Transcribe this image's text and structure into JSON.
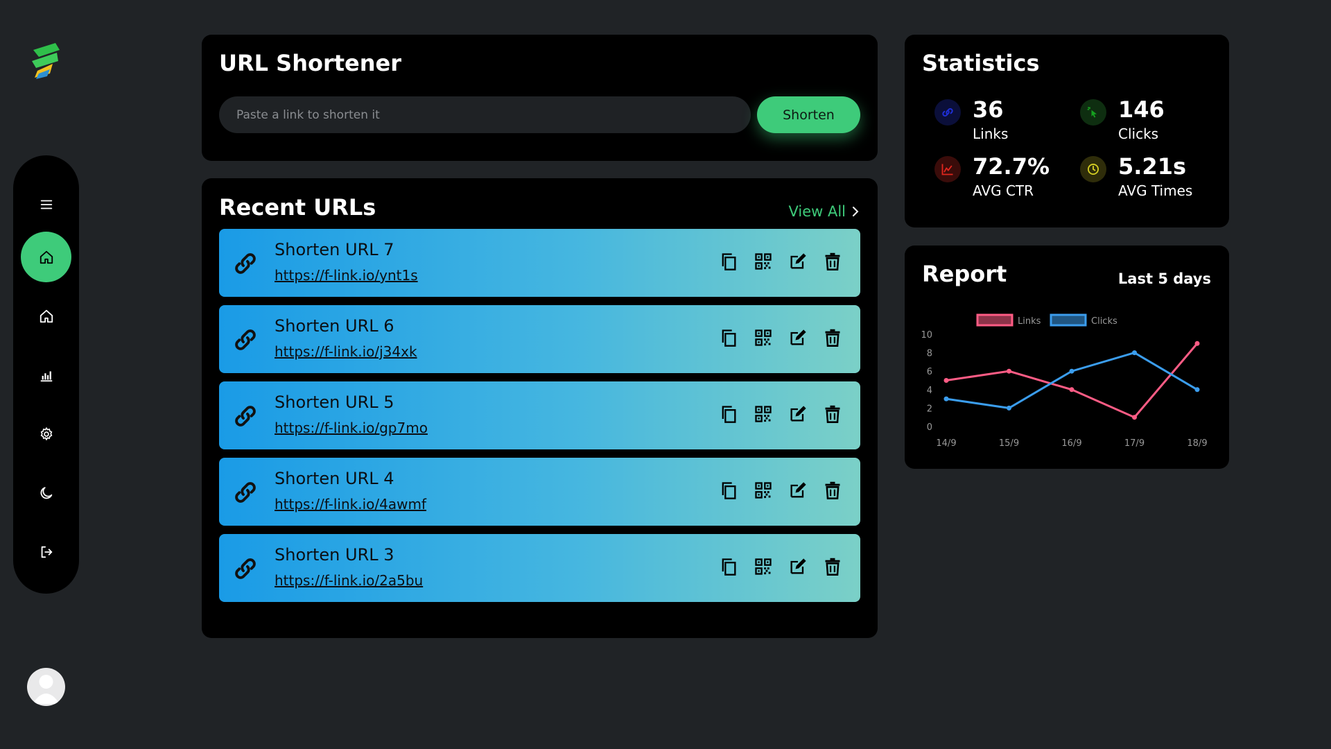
{
  "shortener": {
    "title": "URL Shortener",
    "input_placeholder": "Paste a link to shorten it",
    "button_label": "Shorten"
  },
  "recent": {
    "title": "Recent URLs",
    "view_all": "View All",
    "items": [
      {
        "name": "Shorten URL 7",
        "url": "https://f-link.io/ynt1s"
      },
      {
        "name": "Shorten URL 6",
        "url": "https://f-link.io/j34xk"
      },
      {
        "name": "Shorten URL 5",
        "url": "https://f-link.io/gp7mo"
      },
      {
        "name": "Shorten URL 4",
        "url": "https://f-link.io/4awmf"
      },
      {
        "name": "Shorten URL 3",
        "url": "https://f-link.io/2a5bu"
      }
    ],
    "row_gradient": [
      "#1a9be6",
      "#7bd0c7"
    ]
  },
  "statistics": {
    "title": "Statistics",
    "items": [
      {
        "value": "36",
        "label": "Links",
        "icon": "link-icon",
        "icon_color": "#1f2fd6",
        "icon_bg": "#0b0f3a"
      },
      {
        "value": "146",
        "label": "Clicks",
        "icon": "cursor-click-icon",
        "icon_color": "#16a11f",
        "icon_bg": "#0e2e10"
      },
      {
        "value": "72.7%",
        "label": "AVG CTR",
        "icon": "chart-line-icon",
        "icon_color": "#e0261e",
        "icon_bg": "#3a0c0a"
      },
      {
        "value": "5.21s",
        "label": "AVG Times",
        "icon": "clock-icon",
        "icon_color": "#d6cf24",
        "icon_bg": "#2f2d0a"
      }
    ]
  },
  "report": {
    "title": "Report",
    "range": "Last 5 days"
  },
  "chart_data": {
    "type": "line",
    "x": [
      "14/9",
      "15/9",
      "16/9",
      "17/9",
      "18/9"
    ],
    "series": [
      {
        "name": "Links",
        "values": [
          5,
          6,
          4,
          1,
          9
        ],
        "color": "#ff5c85"
      },
      {
        "name": "Clicks",
        "values": [
          3,
          2,
          6,
          8,
          4
        ],
        "color": "#3b9ded"
      }
    ],
    "ylim": [
      0,
      10
    ],
    "yticks": [
      0,
      2,
      4,
      6,
      8,
      10
    ],
    "legend": "top",
    "grid": false
  },
  "sidebar": {
    "items": [
      {
        "name": "menu",
        "icon": "menu-icon",
        "active": false
      },
      {
        "name": "dashboard",
        "icon": "home-icon",
        "active": true
      },
      {
        "name": "home",
        "icon": "home-icon",
        "active": false
      },
      {
        "name": "analytics",
        "icon": "bar-chart-icon",
        "active": false
      },
      {
        "name": "settings",
        "icon": "gear-icon",
        "active": false
      },
      {
        "name": "dark-mode",
        "icon": "moon-icon",
        "active": false
      },
      {
        "name": "logout",
        "icon": "logout-icon",
        "active": false
      }
    ],
    "accent": "#3ecb7a"
  }
}
